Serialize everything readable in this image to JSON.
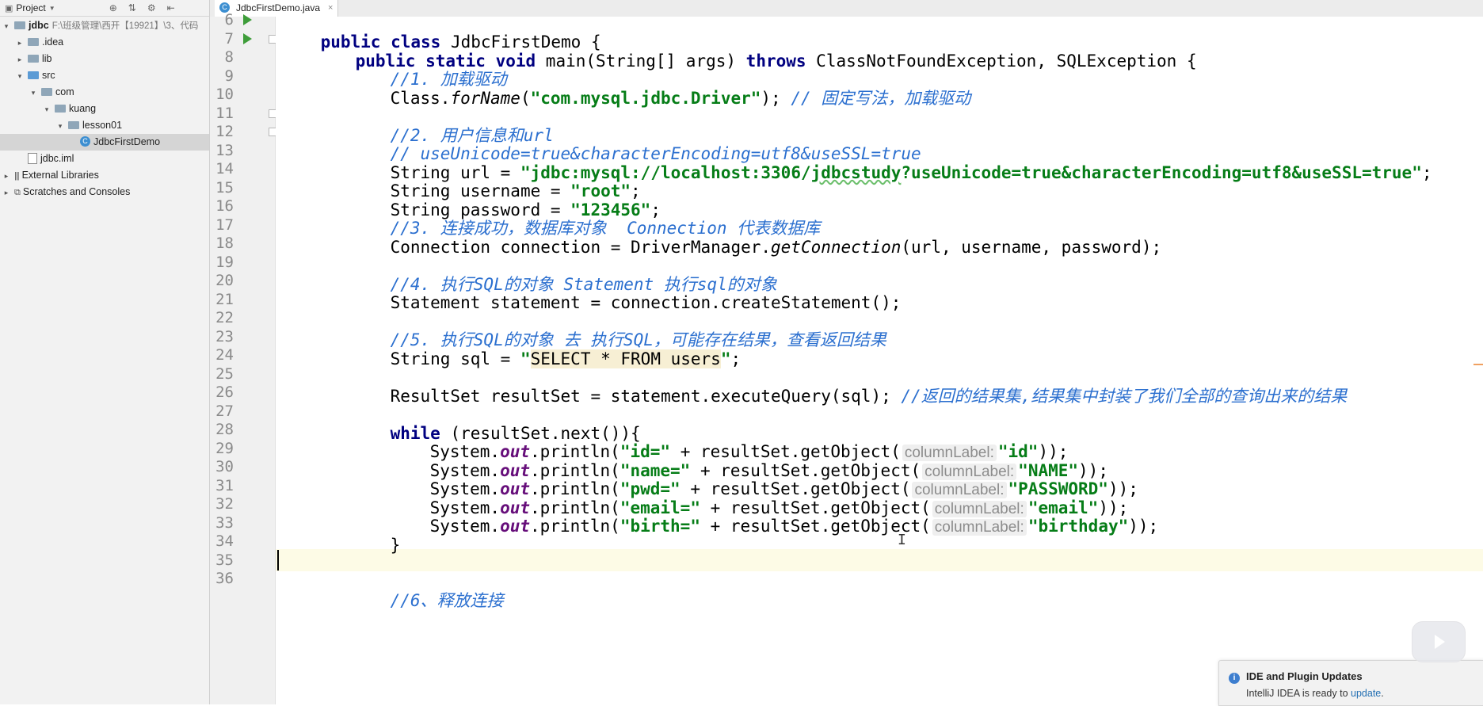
{
  "project_panel": {
    "header": {
      "title": "Project",
      "dropdown_icon": "chevron-down-icon"
    },
    "tree": [
      {
        "label": "jdbc",
        "path_hint": "F:\\班级管理\\西开【19921】\\3、代码",
        "icon": "module-icon",
        "arrow": "expanded",
        "indent": 0,
        "bold": true
      },
      {
        "label": ".idea",
        "icon": "folder-icon",
        "arrow": "collapsed",
        "indent": 1
      },
      {
        "label": "lib",
        "icon": "folder-icon",
        "arrow": "collapsed",
        "indent": 1
      },
      {
        "label": "src",
        "icon": "source-folder-icon",
        "arrow": "expanded",
        "indent": 1
      },
      {
        "label": "com",
        "icon": "package-icon",
        "arrow": "expanded",
        "indent": 2
      },
      {
        "label": "kuang",
        "icon": "package-icon",
        "arrow": "expanded",
        "indent": 3
      },
      {
        "label": "lesson01",
        "icon": "package-icon",
        "arrow": "expanded",
        "indent": 4
      },
      {
        "label": "JdbcFirstDemo",
        "icon": "java-class-icon",
        "arrow": "none",
        "indent": 5,
        "selected": true
      },
      {
        "label": "jdbc.iml",
        "icon": "file-icon",
        "arrow": "none",
        "indent": 1
      },
      {
        "label": "External Libraries",
        "icon": "library-icon",
        "arrow": "collapsed",
        "indent": 0
      },
      {
        "label": "Scratches and Consoles",
        "icon": "scratches-icon",
        "arrow": "collapsed",
        "indent": 0
      }
    ]
  },
  "editor": {
    "tab": {
      "label": "JdbcFirstDemo.java",
      "close": "×"
    },
    "line_numbers": [
      "6",
      "7",
      "8",
      "9",
      "10",
      "11",
      "12",
      "13",
      "14",
      "15",
      "16",
      "17",
      "18",
      "19",
      "20",
      "21",
      "22",
      "23",
      "24",
      "25",
      "26",
      "27",
      "28",
      "29",
      "30",
      "31",
      "32",
      "33",
      "34",
      "35",
      "36"
    ],
    "run_gutter_lines": [
      "6",
      "7"
    ],
    "current_line": "35",
    "code": {
      "l6": {
        "kw1": "public class",
        "rest": " JdbcFirstDemo {"
      },
      "l7": {
        "kw1": "public static void",
        "mid": " main(String[] args) ",
        "kw2": "throws",
        "rest": " ClassNotFoundException, SQLException {"
      },
      "l8": {
        "comment": "//1. 加载驱动"
      },
      "l9": {
        "a": "Class.",
        "b": "forName",
        "c": "(",
        "str": "\"com.mysql.jdbc.Driver\"",
        "d": "); ",
        "comment": "// 固定写法，加载驱动"
      },
      "l11": {
        "comment": "//2. 用户信息和url"
      },
      "l12": {
        "comment": "// useUnicode=true&characterEncoding=utf8&useSSL=true"
      },
      "l13": {
        "a": "String url = ",
        "str1": "\"jdbc:mysql://localhost:3306/",
        "str2": "jdbcstudy",
        "str3": "?useUnicode=true&characterEncoding=utf8&useSSL=true\"",
        "d": ";"
      },
      "l14": {
        "a": "String username = ",
        "str": "\"root\"",
        "d": ";"
      },
      "l15": {
        "a": "String password = ",
        "str": "\"123456\"",
        "d": ";"
      },
      "l16": {
        "comment": "//3. 连接成功，数据库对象  Connection 代表数据库"
      },
      "l17": {
        "a": "Connection connection = DriverManager.",
        "b": "getConnection",
        "c": "(url, username, password);"
      },
      "l19": {
        "comment": "//4. 执行SQL的对象 Statement 执行sql的对象"
      },
      "l20": {
        "a": "Statement statement = connection.createStatement();"
      },
      "l22": {
        "comment": "//5. 执行SQL的对象 去 执行SQL，可能存在结果，查看返回结果"
      },
      "l23": {
        "a": "String sql = ",
        "q1": "\"",
        "sql": "SELECT * FROM users",
        "q2": "\"",
        "d": ";"
      },
      "l25": {
        "a": "ResultSet resultSet = statement.executeQuery(sql); ",
        "comment": "//返回的结果集,结果集中封装了我们全部的查询出来的结果"
      },
      "l27": {
        "kw": "while",
        "rest": " (resultSet.next()){"
      },
      "l28": {
        "a": "System.",
        "field": "out",
        "b": ".println(",
        "str1": "\"id=\"",
        "c": " + resultSet.getObject(",
        "hint": "columnLabel:",
        "str2": "\"id\"",
        "d": "));"
      },
      "l29": {
        "a": "System.",
        "field": "out",
        "b": ".println(",
        "str1": "\"name=\"",
        "c": " + resultSet.getObject(",
        "hint": "columnLabel:",
        "str2": "\"NAME\"",
        "d": "));"
      },
      "l30": {
        "a": "System.",
        "field": "out",
        "b": ".println(",
        "str1": "\"pwd=\"",
        "c": " + resultSet.getObject(",
        "hint": "columnLabel:",
        "str2": "\"PASSWORD\"",
        "d": "));"
      },
      "l31": {
        "a": "System.",
        "field": "out",
        "b": ".println(",
        "str1": "\"email=\"",
        "c": " + resultSet.getObject(",
        "hint": "columnLabel:",
        "str2": "\"email\"",
        "d": "));"
      },
      "l32": {
        "a": "System.",
        "field": "out",
        "b": ".println(",
        "str1": "\"birth=\"",
        "c": " + resultSet.getObject(",
        "hint": "columnLabel:",
        "str2": "\"birthday\"",
        "d": "));"
      },
      "l33": {
        "a": "}"
      },
      "l36": {
        "comment": "//6、释放连接"
      }
    }
  },
  "notification": {
    "icon": "info-icon",
    "title": "IDE and Plugin Updates",
    "body": "IntelliJ IDEA is ready to ",
    "link": "update",
    "end": "."
  },
  "colors": {
    "keyword": "#000080",
    "string": "#067d17",
    "comment": "#2b6fcf",
    "field": "#660e7a",
    "current_line": "#fdfbe6"
  }
}
